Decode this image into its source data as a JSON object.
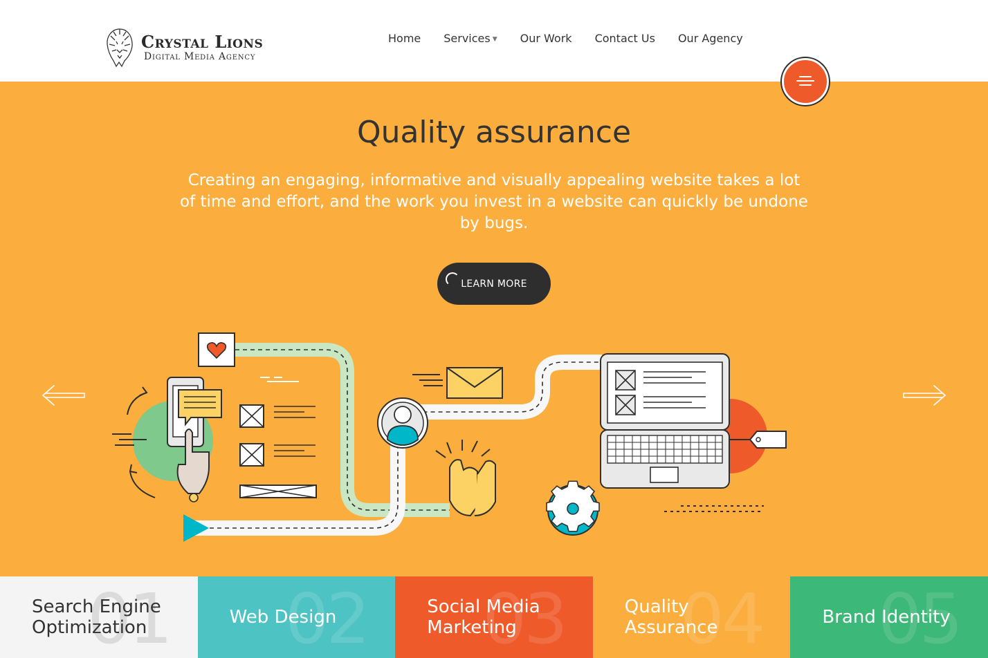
{
  "brand": {
    "name": "Crystal Lions",
    "tagline": "Digital Media Agency"
  },
  "nav": {
    "items": [
      {
        "label": "Home",
        "has_dropdown": false
      },
      {
        "label": "Services",
        "has_dropdown": true
      },
      {
        "label": "Our Work",
        "has_dropdown": false
      },
      {
        "label": "Contact Us",
        "has_dropdown": false
      },
      {
        "label": "Our Agency",
        "has_dropdown": false
      }
    ]
  },
  "hero": {
    "title": "Quality assurance",
    "text": "Creating an engaging, informative and visually appealing website takes a lot of time and effort, and the work you invest in a website can quickly be undone by bugs.",
    "cta_label": "LEARN MORE",
    "background": "#fbad3d",
    "prev_icon": "arrow-left-icon",
    "next_icon": "arrow-right-icon"
  },
  "tiles": [
    {
      "number": "01",
      "label": "Search Engine Optimization",
      "bg": "#f4f4f4",
      "fg": "#333333"
    },
    {
      "number": "02",
      "label": "Web Design",
      "bg": "#4ec3c3",
      "fg": "#ffffff"
    },
    {
      "number": "03",
      "label": "Social Media Marketing",
      "bg": "#ef5a2a",
      "fg": "#ffffff"
    },
    {
      "number": "04",
      "label": "Quality Assurance",
      "bg": "#fbad3d",
      "fg": "#ffffff"
    },
    {
      "number": "05",
      "label": "Brand Identity",
      "bg": "#3cb878",
      "fg": "#ffffff"
    }
  ],
  "colors": {
    "accent": "#ef5a2a",
    "dark": "#2e2e2e",
    "teal": "#00b7c9",
    "green": "#7ec98b"
  }
}
